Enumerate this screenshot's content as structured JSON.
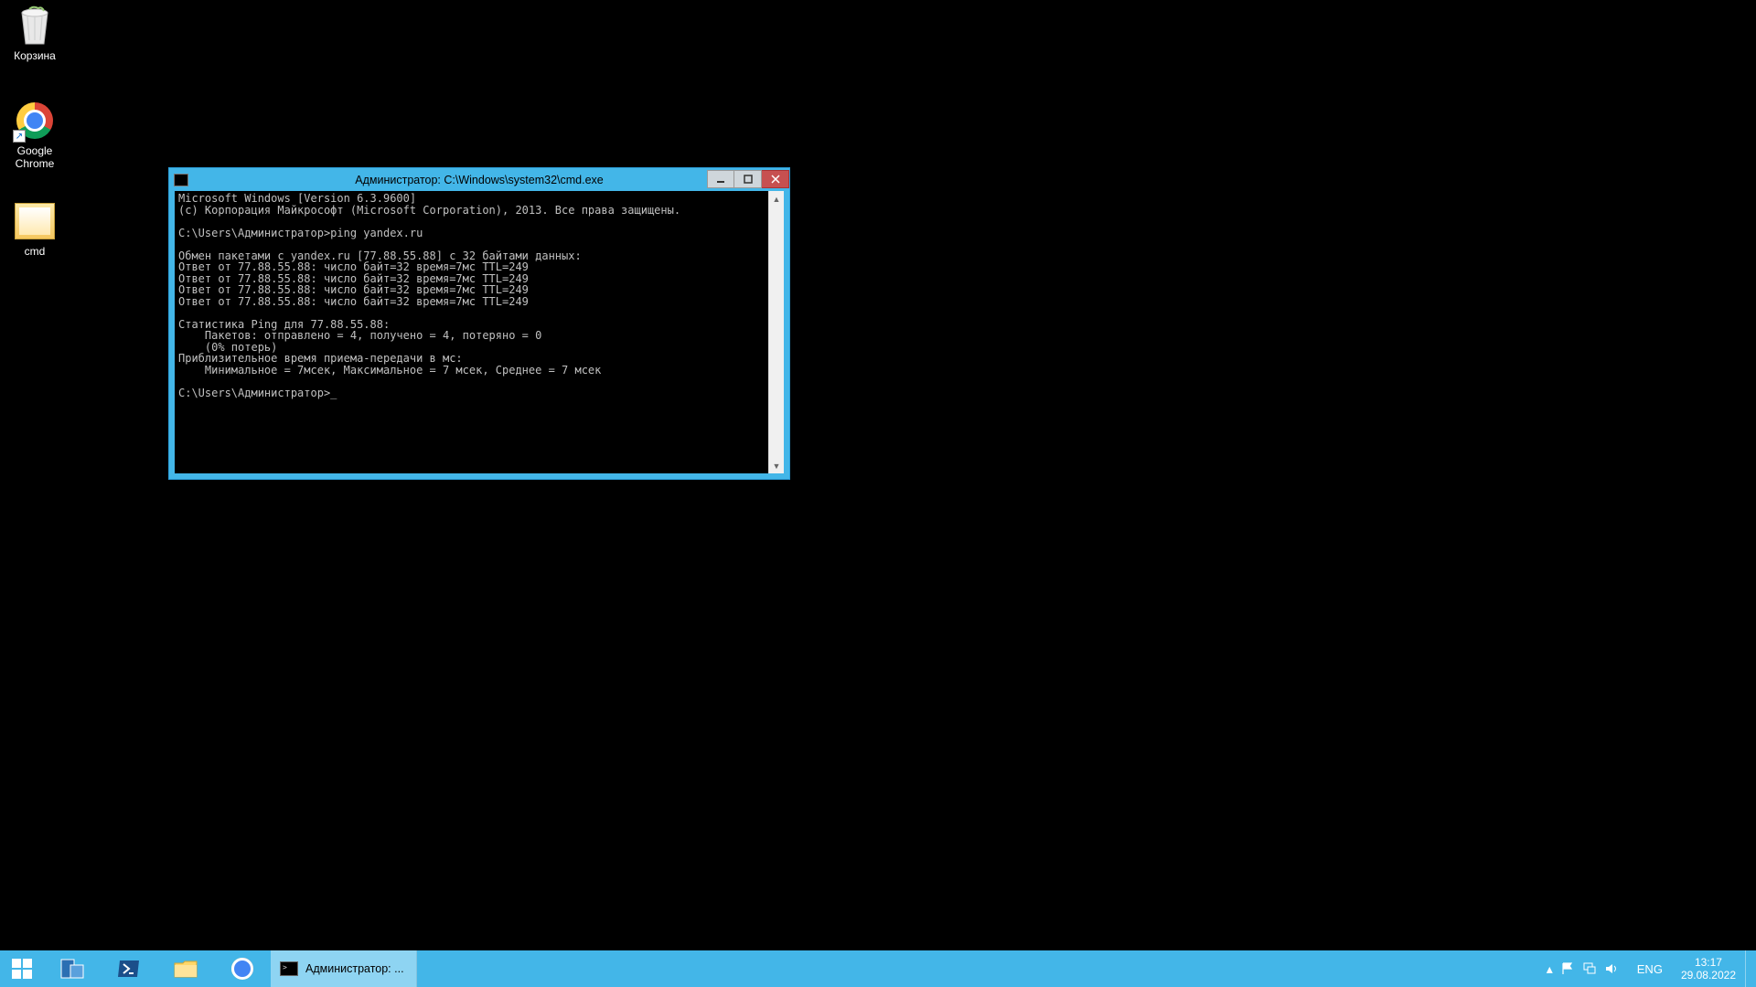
{
  "desktop": {
    "icons": {
      "recycle_bin": "Корзина",
      "chrome": "Google Chrome",
      "cmd": "cmd"
    }
  },
  "cmd_window": {
    "title": "Администратор: C:\\Windows\\system32\\cmd.exe",
    "lines": [
      "Microsoft Windows [Version 6.3.9600]",
      "(c) Корпорация Майкрософт (Microsoft Corporation), 2013. Все права защищены.",
      "",
      "C:\\Users\\Администратор>ping yandex.ru",
      "",
      "Обмен пакетами с yandex.ru [77.88.55.88] с 32 байтами данных:",
      "Ответ от 77.88.55.88: число байт=32 время=7мс TTL=249",
      "Ответ от 77.88.55.88: число байт=32 время=7мс TTL=249",
      "Ответ от 77.88.55.88: число байт=32 время=7мс TTL=249",
      "Ответ от 77.88.55.88: число байт=32 время=7мс TTL=249",
      "",
      "Статистика Ping для 77.88.55.88:",
      "    Пакетов: отправлено = 4, получено = 4, потеряно = 0",
      "    (0% потерь)",
      "Приблизительное время приема-передачи в мс:",
      "    Минимальное = 7мсек, Максимальное = 7 мсек, Среднее = 7 мсек",
      "",
      "C:\\Users\\Администратор>"
    ]
  },
  "taskbar": {
    "active_task": "Администратор: ...",
    "lang": "ENG",
    "time": "13:17",
    "date": "29.08.2022"
  },
  "colors": {
    "accent": "#43b6e8",
    "accent_light": "#8ed4f2",
    "close_red": "#c75050"
  }
}
